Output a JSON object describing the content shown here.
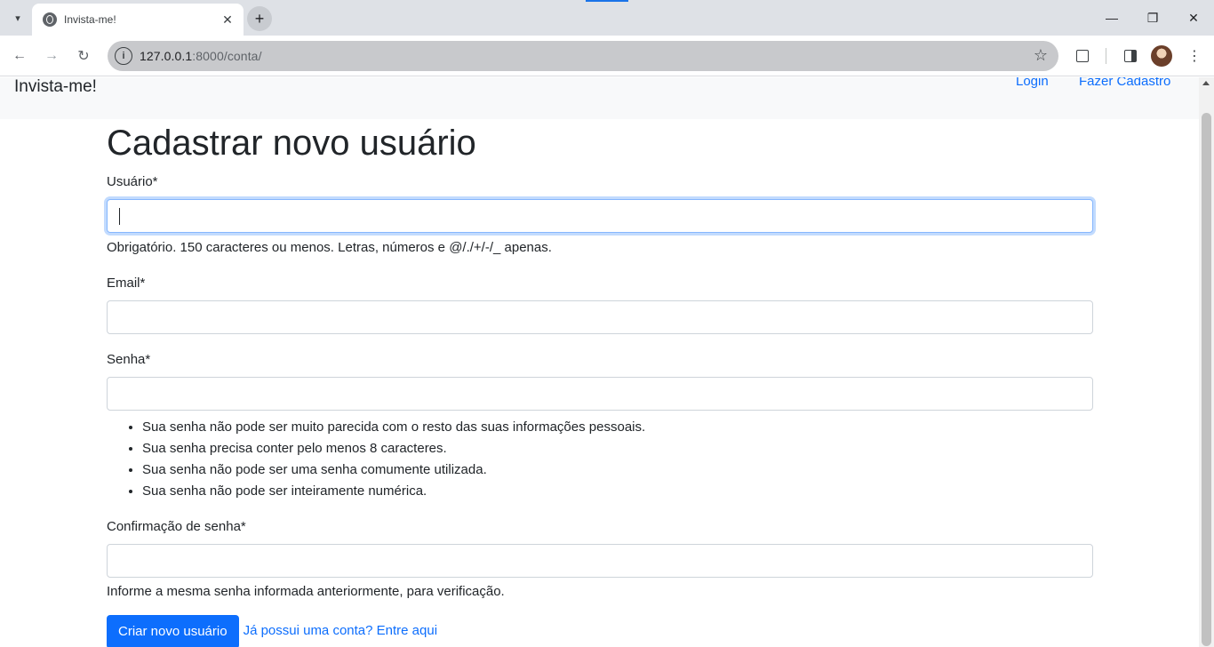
{
  "browser": {
    "tab_title": "Invista-me!",
    "tab_close": "✕",
    "new_tab": "+",
    "url_host": "127.0.0.1",
    "url_rest": ":8000/conta/",
    "window_minimize": "—",
    "window_restore": "❐",
    "window_close": "✕"
  },
  "navbar": {
    "brand": "Invista-me!",
    "login": "Login",
    "signup": "Fazer Cadastro"
  },
  "form": {
    "title": "Cadastrar novo usuário",
    "username_label": "Usuário*",
    "username_value": "",
    "username_help": "Obrigatório. 150 caracteres ou menos. Letras, números e @/./+/-/_ apenas.",
    "email_label": "Email*",
    "email_value": "",
    "password_label": "Senha*",
    "password_value": "",
    "password_rules": [
      "Sua senha não pode ser muito parecida com o resto das suas informações pessoais.",
      "Sua senha precisa conter pelo menos 8 caracteres.",
      "Sua senha não pode ser uma senha comumente utilizada.",
      "Sua senha não pode ser inteiramente numérica."
    ],
    "confirm_label": "Confirmação de senha*",
    "confirm_value": "",
    "confirm_help": "Informe a mesma senha informada anteriormente, para verificação.",
    "submit": "Criar novo usuário",
    "login_link": "Já possui uma conta? Entre aqui"
  },
  "colors": {
    "primary": "#0d6efd",
    "navbar_bg": "#f8f9fa",
    "text": "#212529"
  }
}
